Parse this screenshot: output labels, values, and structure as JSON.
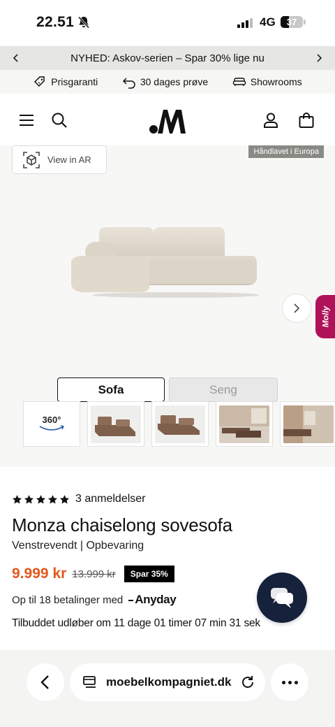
{
  "status": {
    "time": "22.51",
    "network": "4G",
    "battery_level": "37",
    "battery_fraction": 0.37
  },
  "promo": {
    "text": "NYHED: Askov-serien – Spar 30% lige nu"
  },
  "usp": [
    {
      "label": "Prisgaranti",
      "icon": "price-tag-icon"
    },
    {
      "label": "30 dages prøve",
      "icon": "return-arrow-icon"
    },
    {
      "label": "Showrooms",
      "icon": "sofa-icon"
    }
  ],
  "gallery": {
    "ar_label": "View in AR",
    "badge": "Håndlavet i Europa",
    "molly_label": "Molly",
    "toggle": {
      "sofa": "Sofa",
      "seng": "Seng",
      "active": "Sofa"
    },
    "thumb_360_label": "360°"
  },
  "product": {
    "rating_stars": 5,
    "rating_text": "3 anmeldelser",
    "title": "Monza chaiselong sovesofa",
    "subtitle": "Venstrevendt | Opbevaring",
    "price_now": "9.999 kr",
    "price_old": "13.999 kr",
    "discount_badge": "Spar 35%",
    "installments_text": "Op til 18 betalinger med",
    "installments_provider": "Anyday",
    "offer_text": "Tilbuddet udløber om 11 dage 01 timer 07 min 31 sek"
  },
  "browser": {
    "url": "moebelkompagniet.dk"
  },
  "colors": {
    "price": "#e2581e",
    "chat_fab": "#16213b",
    "molly": "#b0125a",
    "badge_bg": "#8a8a84"
  }
}
